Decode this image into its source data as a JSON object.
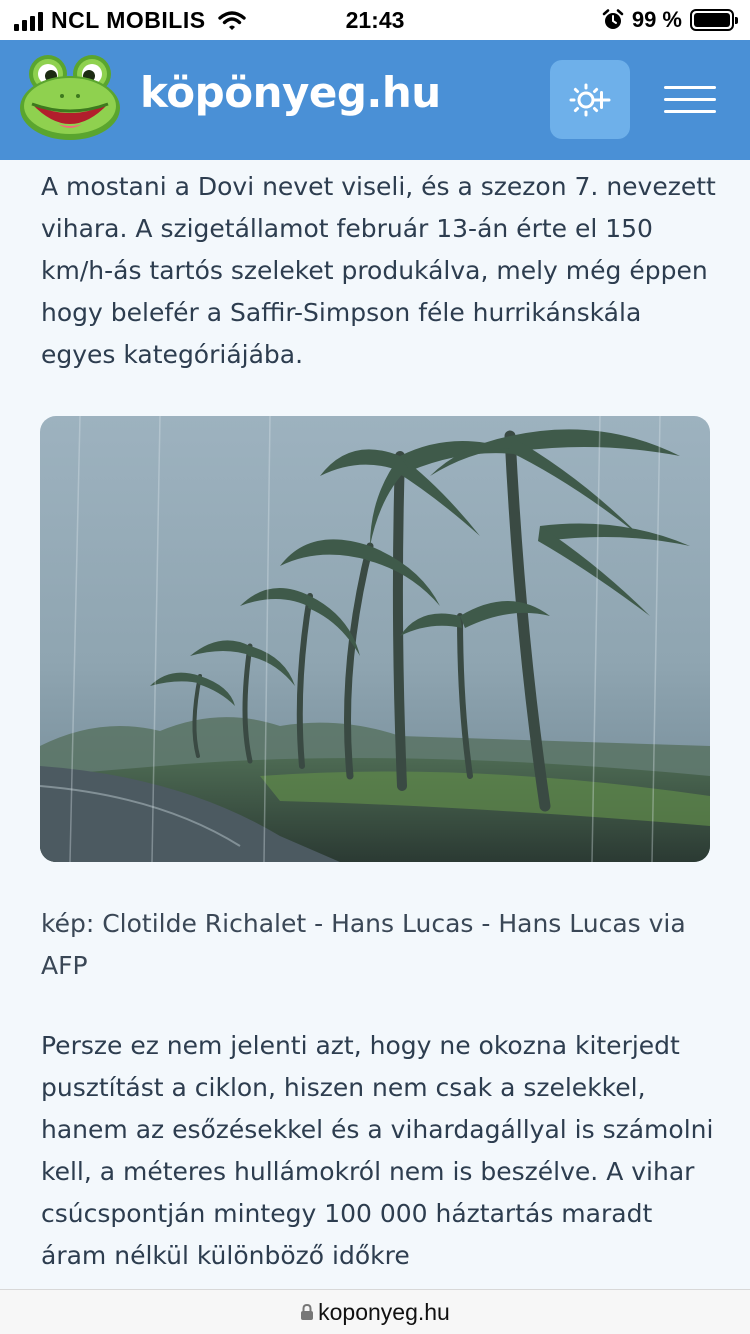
{
  "status_bar": {
    "carrier": "NCL MOBILIS",
    "time": "21:43",
    "battery_percent": "99 %",
    "battery_level": 0.99,
    "icons": [
      "signal-icon",
      "wifi-icon",
      "alarm-icon",
      "battery-icon"
    ]
  },
  "header": {
    "site_name": "köpönyeg.hu",
    "logo_icon": "frog-logo",
    "theme_button_icon": "sun-plus-icon",
    "menu_icon": "hamburger-menu-icon",
    "colors": {
      "header_bg": "#4a90d6",
      "button_bg": "#6eb0ea",
      "frog_green": "#7ac943"
    }
  },
  "article": {
    "paragraph_1": "A mostani a Dovi nevet viseli, és a szezon 7. nevezett vihara. A szigetállamot február 13-án érte el 150 km/h-ás tartós szeleket produkálva, mely még éppen hogy belefér a Saffir-Simpson féle hurrikánskála egyes kategóriájába.",
    "photo_icon": "storm-palm-trees-photo",
    "caption": "kép: Clotilde Richalet - Hans Lucas - Hans Lucas via AFP",
    "paragraph_2": "Persze ez nem jelenti azt, hogy ne okozna kiterjedt pusztítást a ciklon, hiszen nem csak a szelekkel, hanem az esőzésekkel és a vihardagállyal is számolni kell, a méteres hullámokról nem is beszélve. A vihar csúcspontján mintegy 100 000 háztartás maradt áram nélkül különböző időkre"
  },
  "url_bar": {
    "url": "koponyeg.hu",
    "lock_icon": "lock-icon"
  }
}
